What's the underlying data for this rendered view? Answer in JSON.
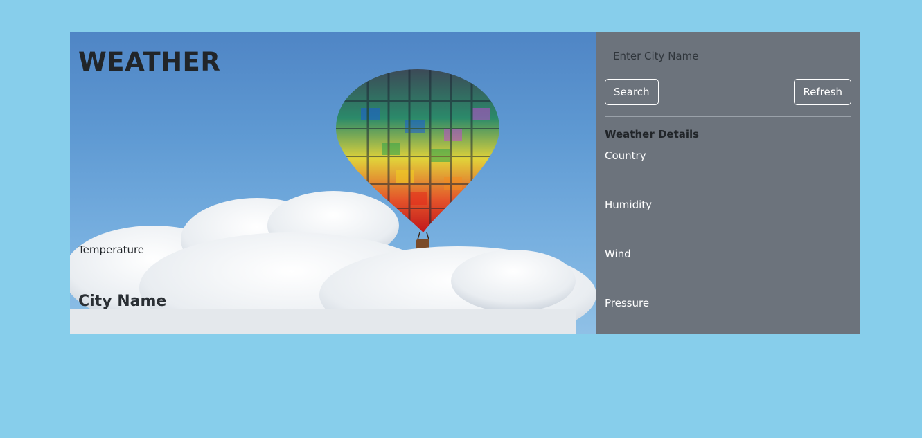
{
  "hero": {
    "title": "WEATHER",
    "temperature_label": "Temperature",
    "city_name": "City Name"
  },
  "search": {
    "placeholder": "Enter City Name",
    "value": ""
  },
  "buttons": {
    "search_label": "Search",
    "refresh_label": "Refresh"
  },
  "details": {
    "title": "Weather Details",
    "items": [
      {
        "label": "Country"
      },
      {
        "label": "Humidity"
      },
      {
        "label": "Wind"
      },
      {
        "label": "Pressure"
      }
    ]
  },
  "colors": {
    "page_background": "#87ceeb",
    "panel_background": "#6c737c",
    "sky": "#5b93cf"
  }
}
